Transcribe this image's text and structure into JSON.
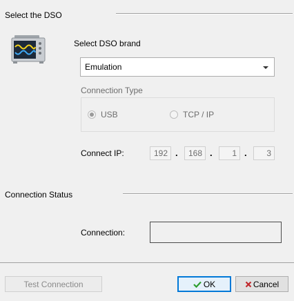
{
  "select_section": {
    "title": "Select the DSO",
    "brand_label": "Select DSO brand",
    "brand_value": "Emulation",
    "connection_type_label": "Connection Type",
    "options": [
      {
        "label": "USB",
        "checked": true
      },
      {
        "label": "TCP / IP",
        "checked": false
      }
    ],
    "connect_ip_label": "Connect IP:",
    "ip": [
      "192",
      "168",
      "1",
      "3"
    ],
    "ip_sep": "."
  },
  "status_section": {
    "title": "Connection Status",
    "connection_label": "Connection:",
    "connection_value": ""
  },
  "buttons": {
    "test": "Test Connection",
    "ok": "OK",
    "ok_icon": "check-icon",
    "cancel": "Cancel",
    "cancel_icon": "x-icon"
  },
  "colors": {
    "ok_check": "#2e9e2e",
    "cancel_x": "#c0282c",
    "focus_border": "#0078d7"
  },
  "icons": {
    "dso": "oscilloscope-icon"
  }
}
